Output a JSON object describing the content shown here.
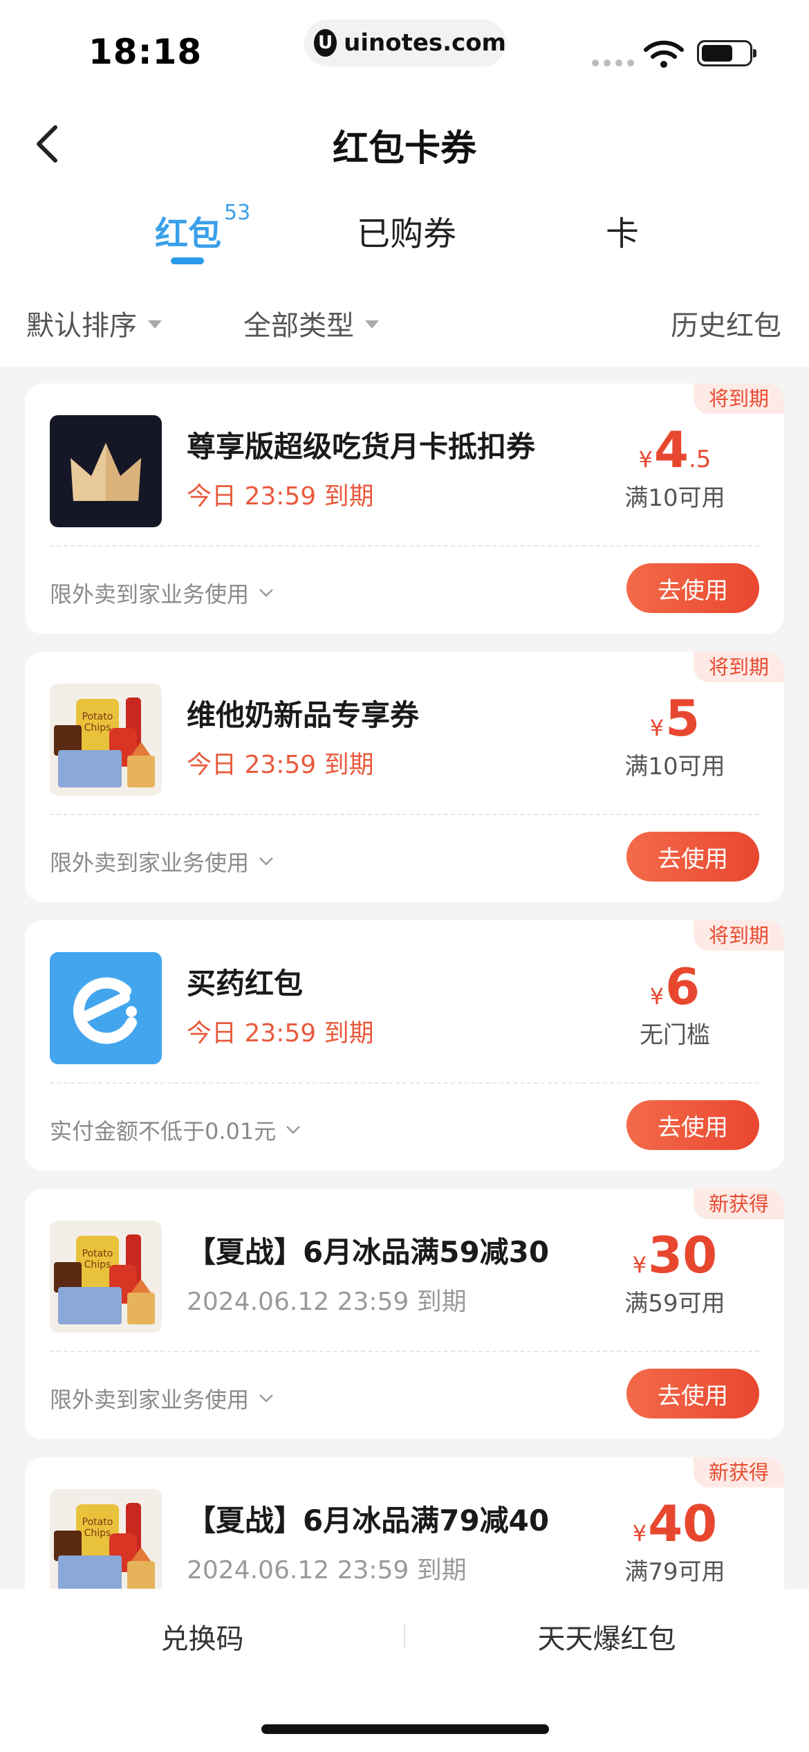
{
  "status_bar": {
    "time": "18:18",
    "url": "uinotes.com",
    "url_logo": "U"
  },
  "header": {
    "title": "红包卡券"
  },
  "tabs": [
    {
      "label": "红包",
      "count": "53",
      "active": true
    },
    {
      "label": "已购券"
    },
    {
      "label": "卡"
    }
  ],
  "filters": {
    "sort": "默认排序",
    "type": "全部类型",
    "history": "历史红包"
  },
  "coupons": [
    {
      "badge": "将到期",
      "thumb": "crown-icon",
      "name": "尊享版超级吃货月卡抵扣券",
      "expiry": "今日 23:59 到期",
      "currency": "¥",
      "amount": "4",
      "amount_decimal": ".5",
      "condition": "满10可用",
      "rule": "限外卖到家业务使用",
      "button": "去使用"
    },
    {
      "badge": "将到期",
      "thumb": "snack-goods-icon",
      "name": "维他奶新品专享券",
      "expiry": "今日 23:59 到期",
      "currency": "¥",
      "amount": "5",
      "amount_decimal": "",
      "condition": "满10可用",
      "rule": "限外卖到家业务使用",
      "button": "去使用"
    },
    {
      "badge": "将到期",
      "thumb": "eleme-logo-icon",
      "name": "买药红包",
      "expiry": "今日 23:59 到期",
      "currency": "¥",
      "amount": "6",
      "amount_decimal": "",
      "condition": "无门槛",
      "rule": "实付金额不低于0.01元",
      "button": "去使用"
    },
    {
      "badge": "新获得",
      "thumb": "snack-goods-icon",
      "name": "【夏战】6月冰品满59减30",
      "expiry": "2024.06.12 23:59 到期",
      "currency": "¥",
      "amount": "30",
      "amount_decimal": "",
      "condition": "满59可用",
      "rule": "限外卖到家业务使用",
      "button": "去使用"
    },
    {
      "badge": "新获得",
      "thumb": "snack-goods-icon",
      "name": "【夏战】6月冰品满79减40",
      "expiry": "2024.06.12 23:59 到期",
      "currency": "¥",
      "amount": "40",
      "amount_decimal": "",
      "condition": "满79可用"
    }
  ],
  "bottom": {
    "redeem": "兑换码",
    "daily": "天天爆红包"
  },
  "colors": {
    "accent_blue": "#2a9bea",
    "price_red": "#e8472f",
    "button_gradient_start": "#f36a4a",
    "button_gradient_end": "#e9472f",
    "badge_bg": "#fdeae6"
  }
}
